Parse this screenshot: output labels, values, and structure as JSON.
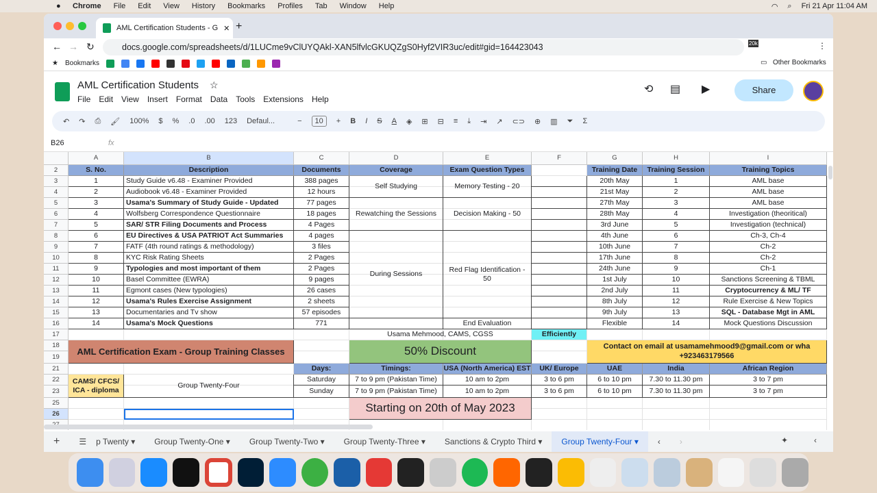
{
  "menubar": {
    "app": "Chrome",
    "items": [
      "File",
      "Edit",
      "View",
      "History",
      "Bookmarks",
      "Profiles",
      "Tab",
      "Window",
      "Help"
    ],
    "clock": "Fri 21 Apr  11:04 AM"
  },
  "browser": {
    "tab_title": "AML Certification Students - G",
    "url": "docs.google.com/spreadsheets/d/1LUCme9vClUYQAkl-XAN5lfvlcGKUQZgS0Hyf2VIR3uc/edit#gid=164423043",
    "bookmarks_label": "Bookmarks",
    "other_bookmarks": "Other Bookmarks",
    "badge": "20k"
  },
  "doc": {
    "title": "AML Certification Students",
    "menu": [
      "File",
      "Edit",
      "View",
      "Insert",
      "Format",
      "Data",
      "Tools",
      "Extensions",
      "Help"
    ],
    "share": "Share"
  },
  "toolbar": {
    "zoom": "100%",
    "currency": "$",
    "percent": "%",
    "dec_minus": ".0",
    "dec_plus": ".00",
    "format123": "123",
    "font": "Defaul...",
    "font_size": "10"
  },
  "formula": {
    "cell_ref": "B26",
    "fx": "fx",
    "value": ""
  },
  "columns": [
    "A",
    "B",
    "C",
    "D",
    "E",
    "F",
    "G",
    "H",
    "I"
  ],
  "row_numbers": [
    "2",
    "3",
    "4",
    "5",
    "6",
    "7",
    "8",
    "9",
    "10",
    "11",
    "12",
    "13",
    "14",
    "15",
    "16",
    "17",
    "18",
    "19",
    "21",
    "22",
    "23",
    "25",
    "26",
    "27"
  ],
  "materials": {
    "headers": [
      "S. No.",
      "Description",
      "Documents"
    ],
    "rows": [
      [
        "1",
        "Study Guide v6.48 - Examiner Provided",
        "388 pages",
        false
      ],
      [
        "2",
        "Audiobook v6.48 - Examiner Provided",
        "12 hours",
        false
      ],
      [
        "3",
        "Usama's Summary of Study Guide - Updated",
        "77 pages",
        true
      ],
      [
        "4",
        "Wolfsberg Correspondence Questionnaire",
        "18 pages",
        false
      ],
      [
        "5",
        "SAR/ STR Filing Documents and Process",
        "4 Pages",
        true
      ],
      [
        "6",
        "EU Directives & USA PATRIOT Act Summaries",
        "4 pages",
        true
      ],
      [
        "7",
        "FATF (4th round ratings & methodology)",
        "3 files",
        false
      ],
      [
        "8",
        "KYC Risk Rating Sheets",
        "2 Pages",
        false
      ],
      [
        "9",
        "Typologies and most important of them",
        "2 Pages",
        true
      ],
      [
        "10",
        "Basel Committee (EWRA)",
        "9 pages",
        false
      ],
      [
        "11",
        "Egmont cases (New typologies)",
        "26 cases",
        false
      ],
      [
        "12",
        "Usama's Rules Exercise Assignment",
        "2 sheets",
        true
      ],
      [
        "13",
        "Documentaries and Tv show",
        "57 episodes",
        false
      ],
      [
        "14",
        "Usama's Mock Questions",
        "771",
        true
      ]
    ]
  },
  "coverage": {
    "headers": [
      "Coverage",
      "Exam Question Types"
    ],
    "groups": [
      [
        "Self Studying",
        "Memory Testing - 20"
      ],
      [
        "Rewatching the Sessions",
        "Decision Making - 50"
      ],
      [
        "During Sessions",
        "Red Flag Identification - 50"
      ]
    ],
    "end": "End Evaluation"
  },
  "training": {
    "headers": [
      "Training Date",
      "Training Session",
      "Training Topics"
    ],
    "rows": [
      [
        "20th May",
        "1",
        "AML base",
        false
      ],
      [
        "21st May",
        "2",
        "AML base",
        false
      ],
      [
        "27th May",
        "3",
        "AML base",
        false
      ],
      [
        "28th May",
        "4",
        "Investigation (theoritical)",
        false
      ],
      [
        "3rd June",
        "5",
        "Investigation (technical)",
        false
      ],
      [
        "4th June",
        "6",
        "Ch-3, Ch-4",
        false
      ],
      [
        "10th June",
        "7",
        "Ch-2",
        false
      ],
      [
        "17th June",
        "8",
        "Ch-2",
        false
      ],
      [
        "24th June",
        "9",
        "Ch-1",
        false
      ],
      [
        "1st July",
        "10",
        "Sanctions Screening & TBML",
        false
      ],
      [
        "2nd July",
        "11",
        "Cryptocurrency & ML/ TF",
        true
      ],
      [
        "8th July",
        "12",
        "Rule Exercise & New Topics",
        false
      ],
      [
        "9th July",
        "13",
        "SQL - Database Mgt in AML",
        true
      ],
      [
        "Flexible",
        "14",
        "Mock Questions Discussion",
        false
      ]
    ]
  },
  "promo": {
    "author": "Usama Mehmood, CAMS, CGSS",
    "efficiently": "Efficiently",
    "banner": "AML Certification Exam - Group Training Classes",
    "discount": "50% Discount",
    "contact1": "Contact on email at usamamehmood9@gmail.com or wha",
    "contact2": "+923463179566",
    "cert": "CAMS/ CFCS/ ICA - diploma",
    "group": "Group Twenty-Four",
    "starting": "Starting on 20th of May 2023"
  },
  "schedule": {
    "headers": [
      "Days:",
      "Timings:",
      "USA (North America) EST",
      "UK/ Europe",
      "UAE",
      "India",
      "African Region"
    ],
    "rows": [
      [
        "Saturday",
        "7 to 9 pm (Pakistan Time)",
        "10 am to 2pm",
        "3 to 6 pm",
        "6 to 10 pm",
        "7.30 to 11.30 pm",
        "3 to 7 pm"
      ],
      [
        "Sunday",
        "7 to 9 pm (Pakistan Time)",
        "10 am to 2pm",
        "3 to 6 pm",
        "6 to 10 pm",
        "7.30 to 11.30 pm",
        "3 to 7 pm"
      ]
    ]
  },
  "sheets": [
    "p Twenty",
    "Group Twenty-One",
    "Group Twenty-Two",
    "Group Twenty-Three",
    "Sanctions & Crypto Third",
    "Group Twenty-Four"
  ],
  "colors": {
    "header_blue": "#8eaadb",
    "banner_red": "#d08570",
    "discount_green": "#93c47d",
    "contact_yellow": "#ffd966",
    "cert_yellow": "#ffe599",
    "efficient_cyan": "#6ff0f5",
    "starting_pink": "#f4cccc",
    "active_sheet": "#0b57d0"
  }
}
